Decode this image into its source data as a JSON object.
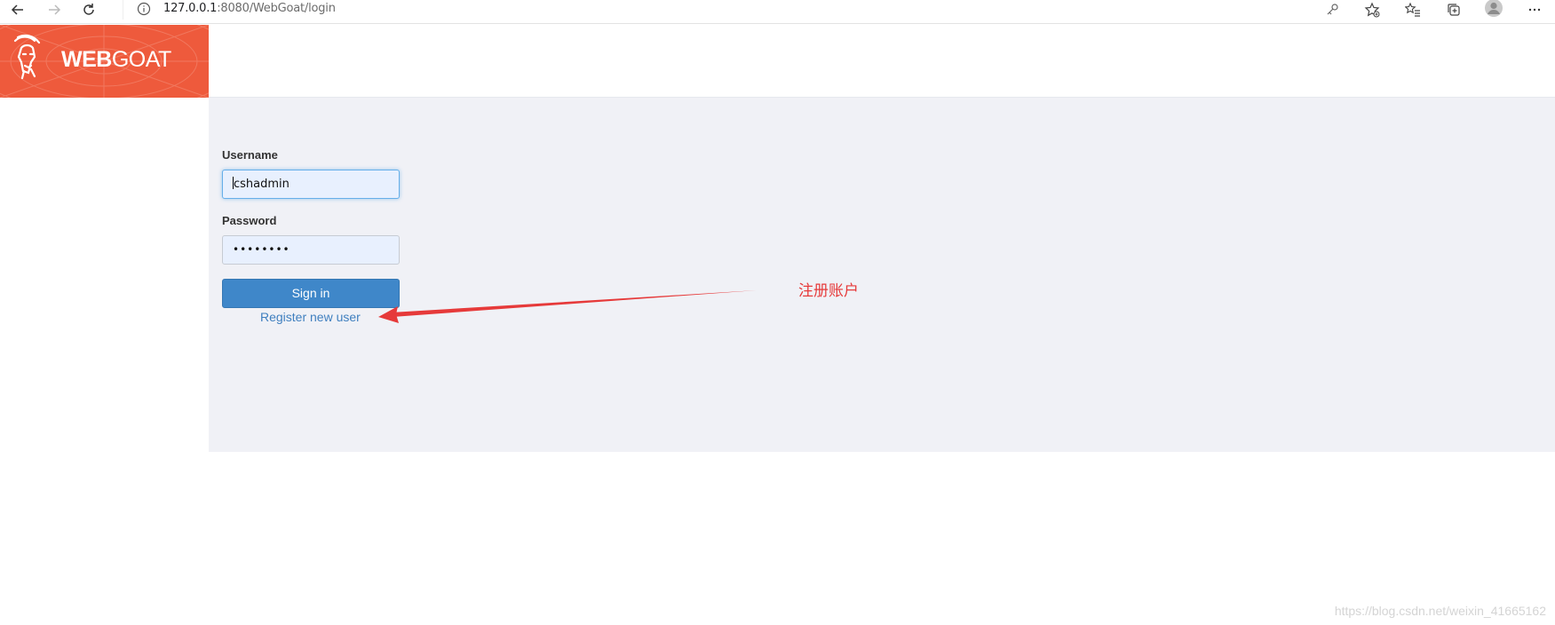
{
  "browser": {
    "url_host": "127.0.0.1",
    "url_rest": ":8080/WebGoat/login",
    "icons": [
      "back-icon",
      "forward-icon",
      "reload-icon",
      "info-icon",
      "key-icon",
      "add-favorite-icon",
      "favorites-icon",
      "collections-icon",
      "profile-icon",
      "more-icon"
    ]
  },
  "header": {
    "logo_bold": "WEB",
    "logo_light": "GOAT",
    "brand_color": "#ee5a3c"
  },
  "login": {
    "username_label": "Username",
    "username_value": "cshadmin",
    "password_label": "Password",
    "password_value": "••••••••",
    "signin_label": "Sign in",
    "register_label": "Register new user"
  },
  "annotation": {
    "text": "注册账户",
    "color": "#e63a3a"
  },
  "watermark": "https://blog.csdn.net/weixin_41665162"
}
